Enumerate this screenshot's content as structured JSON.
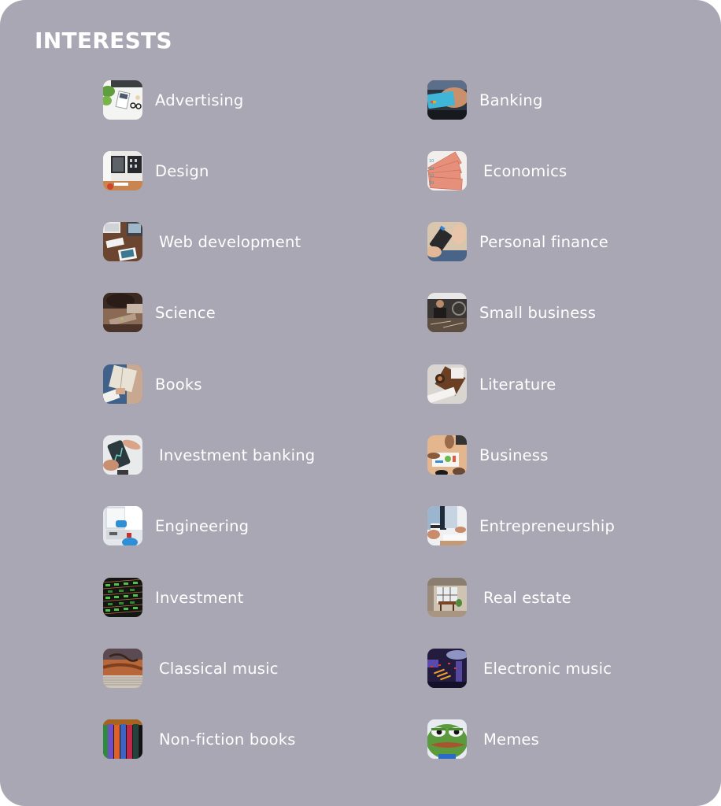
{
  "header": {
    "title": "INTERESTS"
  },
  "colors": {
    "panel_background": "#a8a7b3",
    "text": "#ffffff",
    "page_background": "#ffffff"
  },
  "interests": {
    "left": [
      {
        "label": "Advertising",
        "icon": "advertising-photo-icon"
      },
      {
        "label": "Design",
        "icon": "design-photo-icon"
      },
      {
        "label": "Web development",
        "icon": "web-development-photo-icon"
      },
      {
        "label": "Science",
        "icon": "science-photo-icon"
      },
      {
        "label": "Books",
        "icon": "books-photo-icon"
      },
      {
        "label": "Investment banking",
        "icon": "investment-banking-photo-icon"
      },
      {
        "label": "Engineering",
        "icon": "engineering-photo-icon"
      },
      {
        "label": "Investment",
        "icon": "investment-photo-icon"
      },
      {
        "label": "Classical music",
        "icon": "classical-music-photo-icon"
      },
      {
        "label": "Non-fiction books",
        "icon": "non-fiction-books-photo-icon"
      }
    ],
    "right": [
      {
        "label": "Banking",
        "icon": "banking-photo-icon"
      },
      {
        "label": "Economics",
        "icon": "economics-photo-icon"
      },
      {
        "label": "Personal finance",
        "icon": "personal-finance-photo-icon"
      },
      {
        "label": "Small business",
        "icon": "small-business-photo-icon"
      },
      {
        "label": "Literature",
        "icon": "literature-photo-icon"
      },
      {
        "label": "Business",
        "icon": "business-photo-icon"
      },
      {
        "label": "Entrepreneurship",
        "icon": "entrepreneurship-photo-icon"
      },
      {
        "label": "Real estate",
        "icon": "real-estate-photo-icon"
      },
      {
        "label": "Electronic music",
        "icon": "electronic-music-photo-icon"
      },
      {
        "label": "Memes",
        "icon": "memes-photo-icon"
      }
    ]
  }
}
